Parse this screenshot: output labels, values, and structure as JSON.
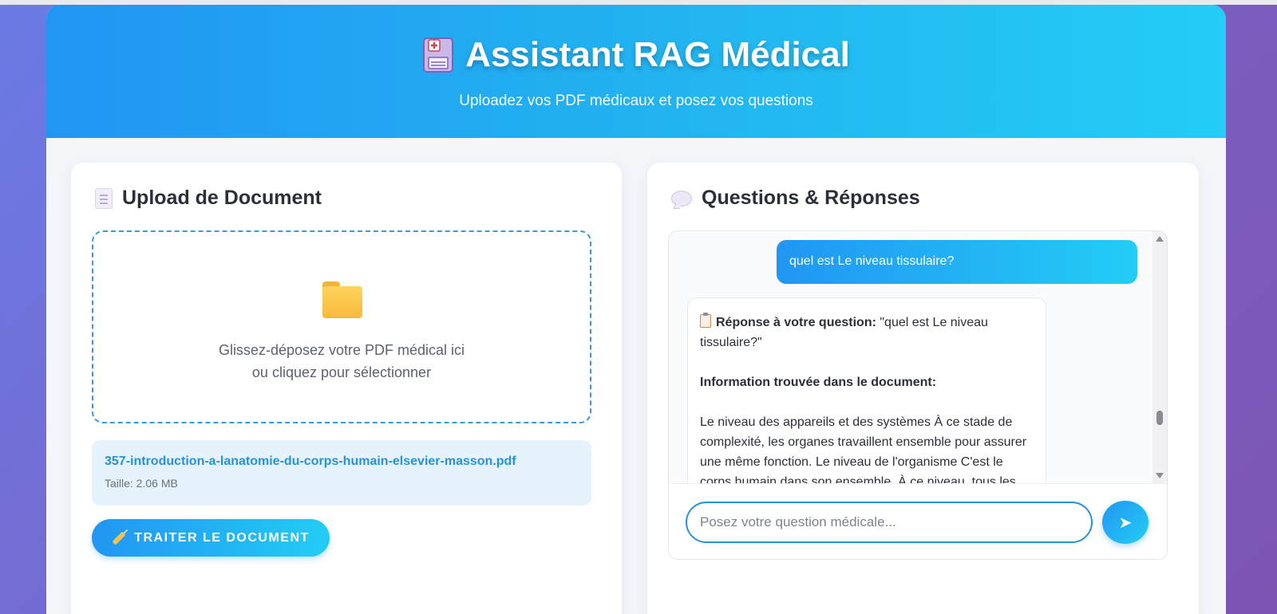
{
  "header": {
    "title": "Assistant RAG Médical",
    "subtitle": "Uploadez vos PDF médicaux et posez vos questions",
    "icon": "floppy-disk-icon"
  },
  "upload": {
    "title": "Upload de Document",
    "icon": "document-icon",
    "dropzone_line1": "Glissez-déposez votre PDF médical ici",
    "dropzone_line2": "ou cliquez pour sélectionner",
    "file_name": "357-introduction-a-lanatomie-du-corps-humain-elsevier-masson.pdf",
    "file_size": "Taille: 2.06 MB",
    "process_label": "TRAITER LE DOCUMENT"
  },
  "chat": {
    "title": "Questions & Réponses",
    "icon": "speech-bubble-icon",
    "user_message": "quel est Le niveau tissulaire?",
    "bot_response_label": "Réponse à votre question:",
    "bot_response_question": "\"quel est Le niveau tissulaire?\"",
    "bot_found_label": "Information trouvée dans le document:",
    "bot_text": "Le niveau des appareils et des systèmes À ce stade de complexité, les organes travaillent ensemble pour assurer une même fonction. Le niveau de l'organisme C'est le corps humain dans son ensemble. À ce niveau, tous les",
    "input_placeholder": "Posez votre question médicale...",
    "send_symbol": "➤"
  },
  "colors": {
    "accent_start": "#2196f3",
    "accent_end": "#23cdf5",
    "link_blue": "#2593db"
  }
}
